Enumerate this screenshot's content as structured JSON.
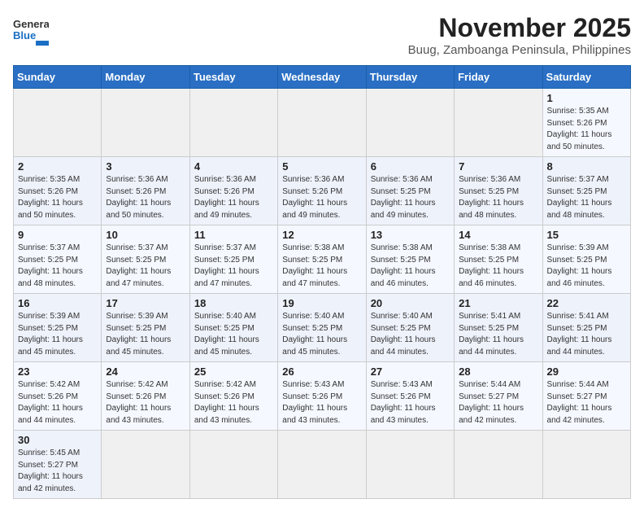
{
  "header": {
    "logo_general": "General",
    "logo_blue": "Blue",
    "month": "November 2025",
    "location": "Buug, Zamboanga Peninsula, Philippines"
  },
  "weekdays": [
    "Sunday",
    "Monday",
    "Tuesday",
    "Wednesday",
    "Thursday",
    "Friday",
    "Saturday"
  ],
  "weeks": [
    [
      {
        "day": "",
        "sunrise": "",
        "sunset": "",
        "daylight": ""
      },
      {
        "day": "",
        "sunrise": "",
        "sunset": "",
        "daylight": ""
      },
      {
        "day": "",
        "sunrise": "",
        "sunset": "",
        "daylight": ""
      },
      {
        "day": "",
        "sunrise": "",
        "sunset": "",
        "daylight": ""
      },
      {
        "day": "",
        "sunrise": "",
        "sunset": "",
        "daylight": ""
      },
      {
        "day": "",
        "sunrise": "",
        "sunset": "",
        "daylight": ""
      },
      {
        "day": "1",
        "sunrise": "Sunrise: 5:35 AM",
        "sunset": "Sunset: 5:26 PM",
        "daylight": "Daylight: 11 hours and 50 minutes."
      }
    ],
    [
      {
        "day": "2",
        "sunrise": "Sunrise: 5:35 AM",
        "sunset": "Sunset: 5:26 PM",
        "daylight": "Daylight: 11 hours and 50 minutes."
      },
      {
        "day": "3",
        "sunrise": "Sunrise: 5:36 AM",
        "sunset": "Sunset: 5:26 PM",
        "daylight": "Daylight: 11 hours and 50 minutes."
      },
      {
        "day": "4",
        "sunrise": "Sunrise: 5:36 AM",
        "sunset": "Sunset: 5:26 PM",
        "daylight": "Daylight: 11 hours and 49 minutes."
      },
      {
        "day": "5",
        "sunrise": "Sunrise: 5:36 AM",
        "sunset": "Sunset: 5:26 PM",
        "daylight": "Daylight: 11 hours and 49 minutes."
      },
      {
        "day": "6",
        "sunrise": "Sunrise: 5:36 AM",
        "sunset": "Sunset: 5:25 PM",
        "daylight": "Daylight: 11 hours and 49 minutes."
      },
      {
        "day": "7",
        "sunrise": "Sunrise: 5:36 AM",
        "sunset": "Sunset: 5:25 PM",
        "daylight": "Daylight: 11 hours and 48 minutes."
      },
      {
        "day": "8",
        "sunrise": "Sunrise: 5:37 AM",
        "sunset": "Sunset: 5:25 PM",
        "daylight": "Daylight: 11 hours and 48 minutes."
      }
    ],
    [
      {
        "day": "9",
        "sunrise": "Sunrise: 5:37 AM",
        "sunset": "Sunset: 5:25 PM",
        "daylight": "Daylight: 11 hours and 48 minutes."
      },
      {
        "day": "10",
        "sunrise": "Sunrise: 5:37 AM",
        "sunset": "Sunset: 5:25 PM",
        "daylight": "Daylight: 11 hours and 47 minutes."
      },
      {
        "day": "11",
        "sunrise": "Sunrise: 5:37 AM",
        "sunset": "Sunset: 5:25 PM",
        "daylight": "Daylight: 11 hours and 47 minutes."
      },
      {
        "day": "12",
        "sunrise": "Sunrise: 5:38 AM",
        "sunset": "Sunset: 5:25 PM",
        "daylight": "Daylight: 11 hours and 47 minutes."
      },
      {
        "day": "13",
        "sunrise": "Sunrise: 5:38 AM",
        "sunset": "Sunset: 5:25 PM",
        "daylight": "Daylight: 11 hours and 46 minutes."
      },
      {
        "day": "14",
        "sunrise": "Sunrise: 5:38 AM",
        "sunset": "Sunset: 5:25 PM",
        "daylight": "Daylight: 11 hours and 46 minutes."
      },
      {
        "day": "15",
        "sunrise": "Sunrise: 5:39 AM",
        "sunset": "Sunset: 5:25 PM",
        "daylight": "Daylight: 11 hours and 46 minutes."
      }
    ],
    [
      {
        "day": "16",
        "sunrise": "Sunrise: 5:39 AM",
        "sunset": "Sunset: 5:25 PM",
        "daylight": "Daylight: 11 hours and 45 minutes."
      },
      {
        "day": "17",
        "sunrise": "Sunrise: 5:39 AM",
        "sunset": "Sunset: 5:25 PM",
        "daylight": "Daylight: 11 hours and 45 minutes."
      },
      {
        "day": "18",
        "sunrise": "Sunrise: 5:40 AM",
        "sunset": "Sunset: 5:25 PM",
        "daylight": "Daylight: 11 hours and 45 minutes."
      },
      {
        "day": "19",
        "sunrise": "Sunrise: 5:40 AM",
        "sunset": "Sunset: 5:25 PM",
        "daylight": "Daylight: 11 hours and 45 minutes."
      },
      {
        "day": "20",
        "sunrise": "Sunrise: 5:40 AM",
        "sunset": "Sunset: 5:25 PM",
        "daylight": "Daylight: 11 hours and 44 minutes."
      },
      {
        "day": "21",
        "sunrise": "Sunrise: 5:41 AM",
        "sunset": "Sunset: 5:25 PM",
        "daylight": "Daylight: 11 hours and 44 minutes."
      },
      {
        "day": "22",
        "sunrise": "Sunrise: 5:41 AM",
        "sunset": "Sunset: 5:25 PM",
        "daylight": "Daylight: 11 hours and 44 minutes."
      }
    ],
    [
      {
        "day": "23",
        "sunrise": "Sunrise: 5:42 AM",
        "sunset": "Sunset: 5:26 PM",
        "daylight": "Daylight: 11 hours and 44 minutes."
      },
      {
        "day": "24",
        "sunrise": "Sunrise: 5:42 AM",
        "sunset": "Sunset: 5:26 PM",
        "daylight": "Daylight: 11 hours and 43 minutes."
      },
      {
        "day": "25",
        "sunrise": "Sunrise: 5:42 AM",
        "sunset": "Sunset: 5:26 PM",
        "daylight": "Daylight: 11 hours and 43 minutes."
      },
      {
        "day": "26",
        "sunrise": "Sunrise: 5:43 AM",
        "sunset": "Sunset: 5:26 PM",
        "daylight": "Daylight: 11 hours and 43 minutes."
      },
      {
        "day": "27",
        "sunrise": "Sunrise: 5:43 AM",
        "sunset": "Sunset: 5:26 PM",
        "daylight": "Daylight: 11 hours and 43 minutes."
      },
      {
        "day": "28",
        "sunrise": "Sunrise: 5:44 AM",
        "sunset": "Sunset: 5:27 PM",
        "daylight": "Daylight: 11 hours and 42 minutes."
      },
      {
        "day": "29",
        "sunrise": "Sunrise: 5:44 AM",
        "sunset": "Sunset: 5:27 PM",
        "daylight": "Daylight: 11 hours and 42 minutes."
      }
    ],
    [
      {
        "day": "30",
        "sunrise": "Sunrise: 5:45 AM",
        "sunset": "Sunset: 5:27 PM",
        "daylight": "Daylight: 11 hours and 42 minutes."
      },
      {
        "day": "",
        "sunrise": "",
        "sunset": "",
        "daylight": ""
      },
      {
        "day": "",
        "sunrise": "",
        "sunset": "",
        "daylight": ""
      },
      {
        "day": "",
        "sunrise": "",
        "sunset": "",
        "daylight": ""
      },
      {
        "day": "",
        "sunrise": "",
        "sunset": "",
        "daylight": ""
      },
      {
        "day": "",
        "sunrise": "",
        "sunset": "",
        "daylight": ""
      },
      {
        "day": "",
        "sunrise": "",
        "sunset": "",
        "daylight": ""
      }
    ]
  ]
}
